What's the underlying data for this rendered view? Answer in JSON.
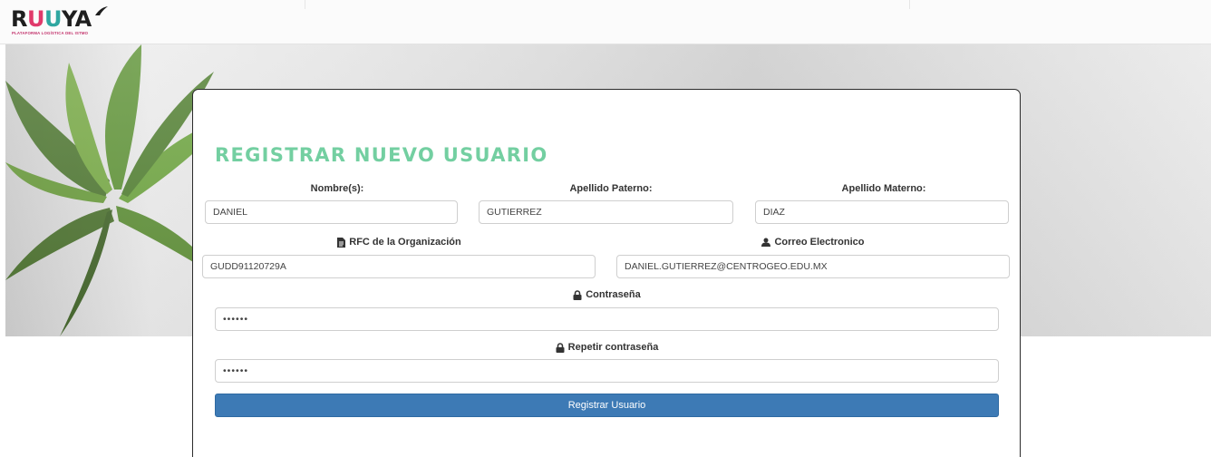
{
  "brand": {
    "logo_letters": [
      "R",
      "U",
      "U",
      "YA"
    ],
    "tagline": "PLATAFORMA LOGÍSTICA DEL ISTMO"
  },
  "form": {
    "title": "REGISTRAR NUEVO USUARIO",
    "nombre": {
      "label": "Nombre(s):",
      "value": "DANIEL"
    },
    "apellido_paterno": {
      "label": "Apellido Paterno:",
      "value": "GUTIERREZ"
    },
    "apellido_materno": {
      "label": "Apellido Materno:",
      "value": "DIAZ"
    },
    "rfc": {
      "label": "RFC de la Organización",
      "value": "GUDD91120729A",
      "icon": "file-icon"
    },
    "correo": {
      "label": "Correo Electronico",
      "value": "DANIEL.GUTIERREZ@CENTROGEO.EDU.MX",
      "icon": "user-icon"
    },
    "contrasena": {
      "label": "Contraseña",
      "value": "••••••",
      "icon": "lock-icon"
    },
    "repetir_contrasena": {
      "label": "Repetir contraseña",
      "value": "••••••",
      "icon": "lock-icon"
    },
    "submit_label": "Registrar Usuario"
  },
  "colors": {
    "title_green": "#73cfa1",
    "button_blue": "#3d7ab5",
    "logo_pink": "#e03a6b",
    "logo_teal": "#2fa7a1"
  }
}
